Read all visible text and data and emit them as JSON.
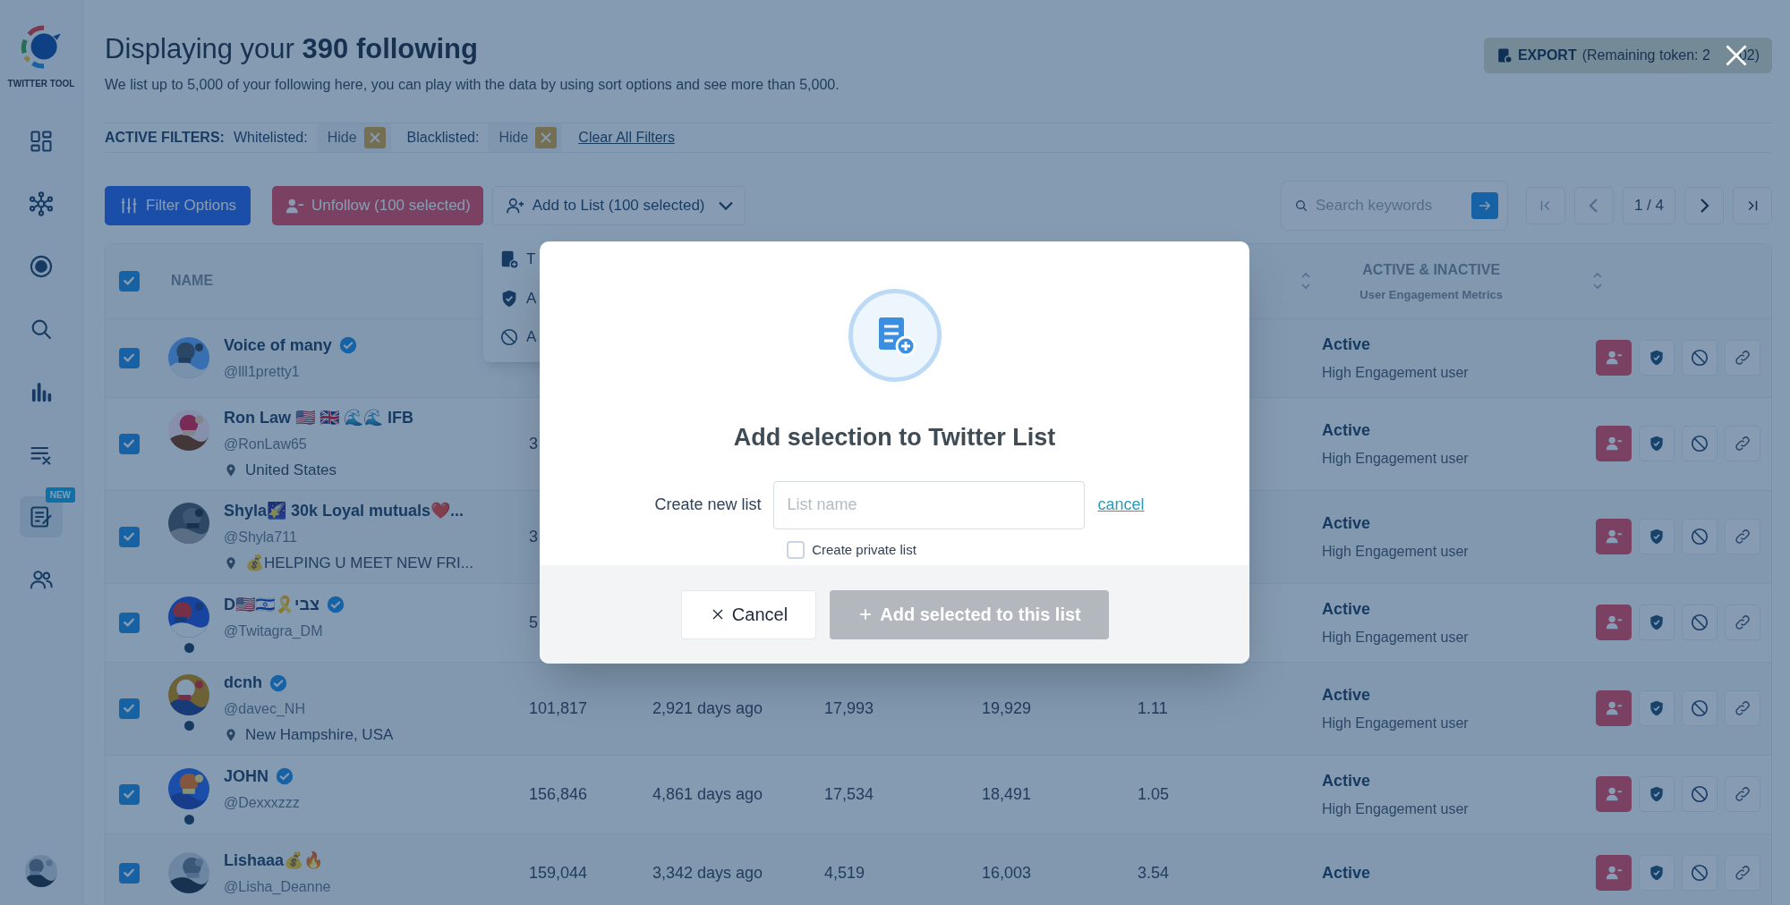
{
  "sidebar": {
    "logo_text": "TWITTER TOOL",
    "items": [
      {
        "kind": "dashboard",
        "selected": false
      },
      {
        "kind": "network",
        "selected": false
      },
      {
        "kind": "target",
        "selected": false
      },
      {
        "kind": "search",
        "selected": false
      },
      {
        "kind": "chart",
        "selected": false
      },
      {
        "kind": "clear-list",
        "selected": false
      },
      {
        "kind": "edit",
        "selected": true,
        "badge": "NEW"
      },
      {
        "kind": "users",
        "selected": false
      }
    ]
  },
  "header": {
    "title": "Displaying your **390 following**",
    "subtitle": "We list up to 5,000 of your following here, you can play with the data by using sort options and see more than 5,000.",
    "export_label": "EXPORT",
    "export_note": [
      "(Remaining token: 2",
      "02)"
    ]
  },
  "filters": {
    "label": "ACTIVE FILTERS:",
    "items": [
      {
        "name": "Whitelisted:",
        "value": "Hide"
      },
      {
        "name": "Blacklisted:",
        "value": "Hide"
      }
    ],
    "clear": "Clear All Filters"
  },
  "toolbar": {
    "filter_button": "Filter Options",
    "unfollow_button": "Unfollow (100 selected)",
    "add_to_list_button": "Add to List (100 selected)",
    "search": {
      "placeholder": "Search keywords"
    },
    "page": "1 / 4"
  },
  "dropdown": {
    "items": [
      {
        "kind": "list",
        "label": "T"
      },
      {
        "kind": "shield",
        "label": "A"
      },
      {
        "kind": "block",
        "label": "A"
      }
    ]
  },
  "table": {
    "select_all_checked": true,
    "name_column": "NAME",
    "engagement_column": {
      "title": "ACTIVE & INACTIVE",
      "subtitle": "User Engagement Metrics"
    },
    "rows": [
      {
        "checked": true,
        "name": "Voice of many",
        "verified": true,
        "handle": "@lll1pretty1",
        "status_dot": false,
        "status": "Active",
        "engagement": "High Engagement user"
      },
      {
        "checked": true,
        "name": "Ron Law 🇺🇸 🇬🇧 🌊🌊 IFB",
        "verified": false,
        "handle": "@RonLaw65",
        "location": "United States",
        "status_dot": false,
        "followers": "3",
        "status": "Active",
        "engagement": "High Engagement user"
      },
      {
        "checked": true,
        "name": "Shyla🌠 30k Loyal mutuals❤️...",
        "verified": false,
        "handle": "@Shyla711",
        "location": "💰HELPING U MEET NEW FRI...",
        "status_dot": false,
        "followers": "3",
        "status": "Active",
        "engagement": "High Engagement user"
      },
      {
        "checked": true,
        "name": "D🇺🇸🇮🇱🎗️צבי",
        "verified": true,
        "handle": "@Twitagra_DM",
        "status_dot": true,
        "followers": "5",
        "status": "Active",
        "engagement": "High Engagement user"
      },
      {
        "checked": true,
        "name": "dcnh",
        "verified": true,
        "handle": "@davec_NH",
        "location": "New Hampshire, USA",
        "status_dot": true,
        "followers": "101,817",
        "last_seen": "2,921 days ago",
        "column_3": "17,993",
        "column_4": "19,929",
        "column_5": "1.11",
        "status": "Active",
        "engagement": "High Engagement user"
      },
      {
        "checked": true,
        "name": "JOHN",
        "verified": true,
        "handle": "@Dexxxzzz",
        "status_dot": true,
        "followers": "156,846",
        "last_seen": "4,861 days ago",
        "column_3": "17,534",
        "column_4": "18,491",
        "column_5": "1.05",
        "status": "Active",
        "engagement": "High Engagement user"
      },
      {
        "checked": true,
        "name": "Lishaaa💰🔥",
        "verified": false,
        "handle": "@Lisha_Deanne",
        "status_dot": false,
        "followers": "159,044",
        "last_seen": "3,342 days ago",
        "column_3": "4,519",
        "column_4": "16,003",
        "column_5": "3.54",
        "status": "Active"
      }
    ]
  },
  "modal": {
    "title": "Add selection to Twitter List",
    "field_label": "Create new list",
    "placeholder": "List name",
    "cancel_link": "cancel",
    "private_label": "Create private list",
    "private_checked": false,
    "buttons": [
      {
        "kind": "cancel",
        "label": "Cancel",
        "disabled": false
      },
      {
        "kind": "add",
        "label": "Add selected to this list",
        "disabled": true
      }
    ]
  }
}
